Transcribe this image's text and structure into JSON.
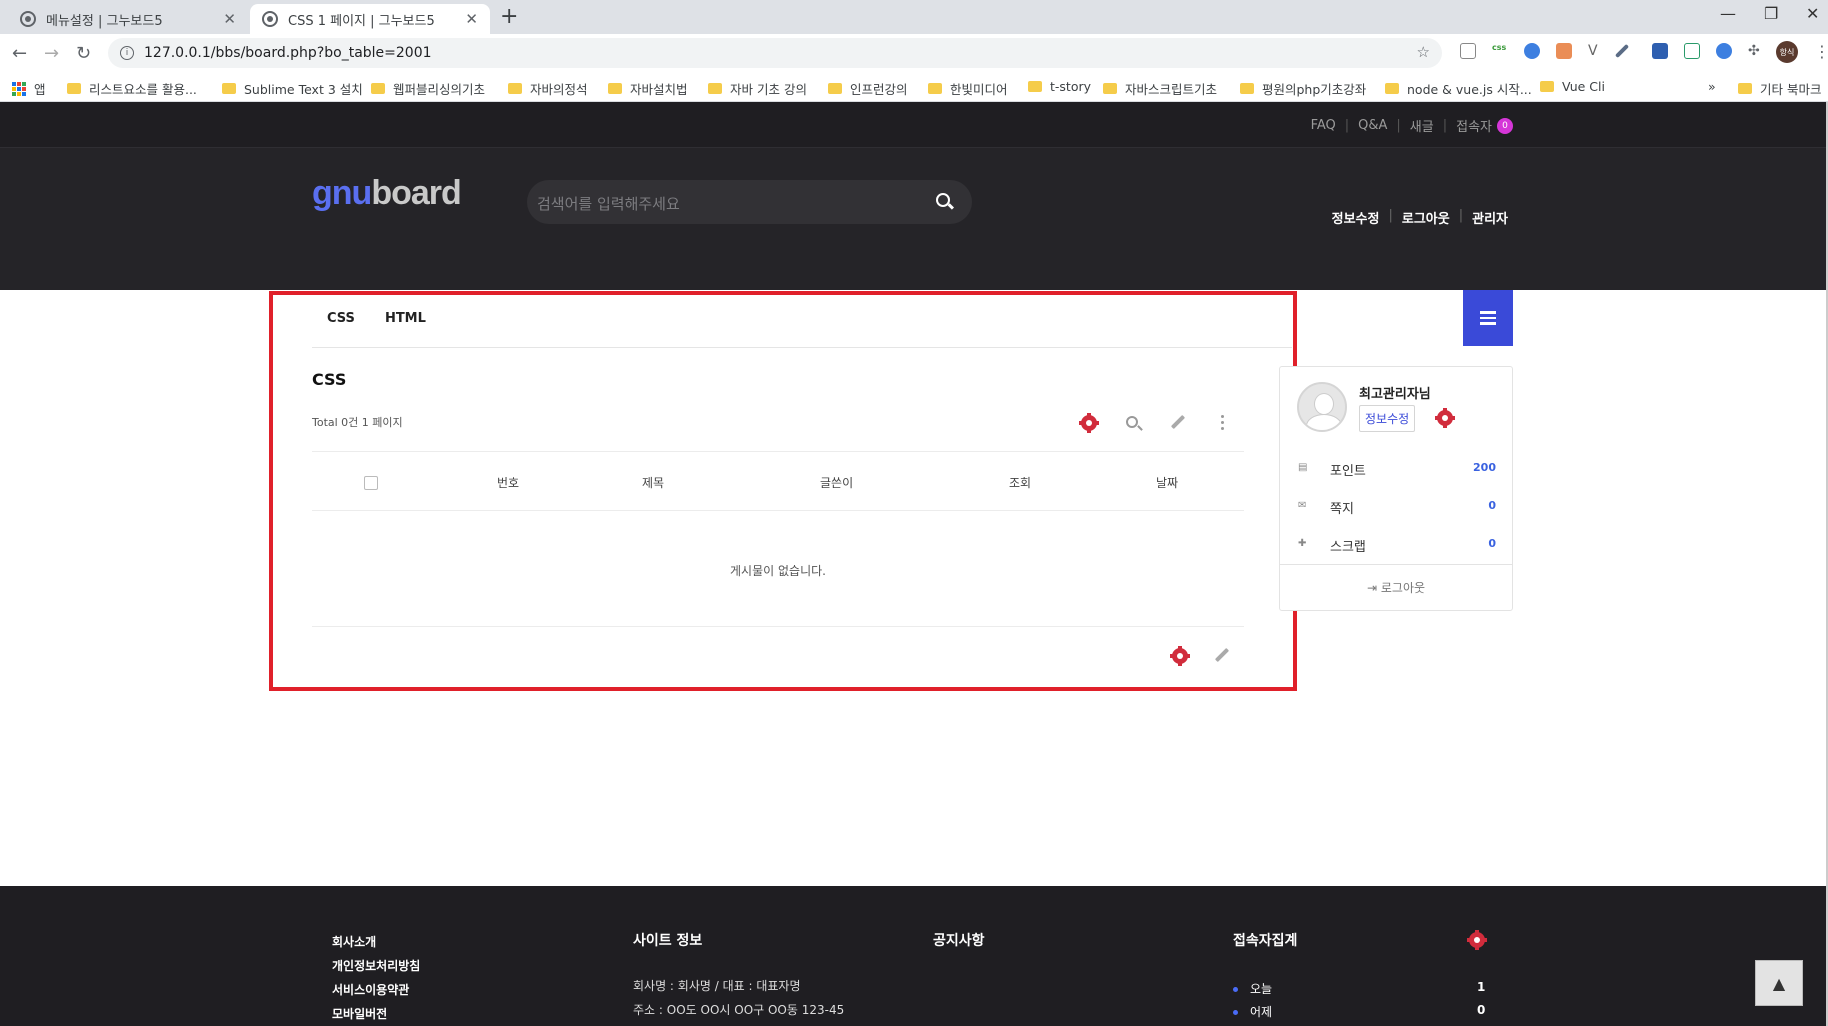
{
  "browser": {
    "tabs": [
      {
        "title": "메뉴설정 | 그누보드5",
        "active": false
      },
      {
        "title": "CSS 1 페이지 | 그누보드5",
        "active": true
      }
    ],
    "url": "127.0.0.1/bbs/board.php?bo_table=2001",
    "avatar_text": "항식",
    "bookmarks": [
      {
        "label": "앱",
        "type": "apps"
      },
      {
        "label": "리스트요소를 활용...",
        "type": "folder"
      },
      {
        "label": "Sublime Text 3 설치",
        "type": "folder"
      },
      {
        "label": "웹퍼블리싱의기초",
        "type": "folder"
      },
      {
        "label": "자바의정석",
        "type": "folder"
      },
      {
        "label": "자바설치법",
        "type": "folder"
      },
      {
        "label": "자바 기초 강의",
        "type": "folder"
      },
      {
        "label": "인프런강의",
        "type": "folder"
      },
      {
        "label": "한빛미디어",
        "type": "folder"
      },
      {
        "label": "t-story",
        "type": "folder"
      },
      {
        "label": "자바스크립트기초",
        "type": "folder"
      },
      {
        "label": "평원의php기초강좌",
        "type": "folder"
      },
      {
        "label": "node & vue.js 시작...",
        "type": "folder"
      },
      {
        "label": "Vue Cli",
        "type": "folder"
      }
    ],
    "bookmarks_overflow": "»",
    "other_bookmarks": "기타 북마크"
  },
  "site": {
    "toplinks": [
      "FAQ",
      "Q&A",
      "새글",
      "접속자"
    ],
    "visitor_badge": "0",
    "logo": {
      "part1": "gnu",
      "part2": "board"
    },
    "search_placeholder": "검색어를 입력해주세요",
    "usernav": [
      "정보수정",
      "로그아웃",
      "관리자"
    ],
    "menu": [
      "CSS",
      "HTML"
    ],
    "accent_color": "#3a4ad8"
  },
  "board": {
    "title": "CSS",
    "total_text": "Total 0건 1 페이지",
    "columns": [
      "번호",
      "제목",
      "글쓴이",
      "조회",
      "날짜"
    ],
    "empty_message": "게시물이 없습니다."
  },
  "sidebar": {
    "nickname": "최고관리자님",
    "edit_label": "정보수정",
    "rows": [
      {
        "label": "포인트",
        "value": "200"
      },
      {
        "label": "쪽지",
        "value": "0"
      },
      {
        "label": "스크랩",
        "value": "0"
      }
    ],
    "logout_label": "로그아웃"
  },
  "footer": {
    "links": [
      "회사소개",
      "개인정보처리방침",
      "서비스이용약관",
      "모바일버전"
    ],
    "site_info_title": "사이트 정보",
    "site_info_lines": [
      "회사명 : 회사명 / 대표 : 대표자명",
      "주소 : OO도 OO시 OO구 OO동 123-45"
    ],
    "notice_title": "공지사항",
    "visitor_title": "접속자집계",
    "stats": [
      {
        "label": "오늘",
        "value": "1"
      },
      {
        "label": "어제",
        "value": "0"
      }
    ]
  }
}
